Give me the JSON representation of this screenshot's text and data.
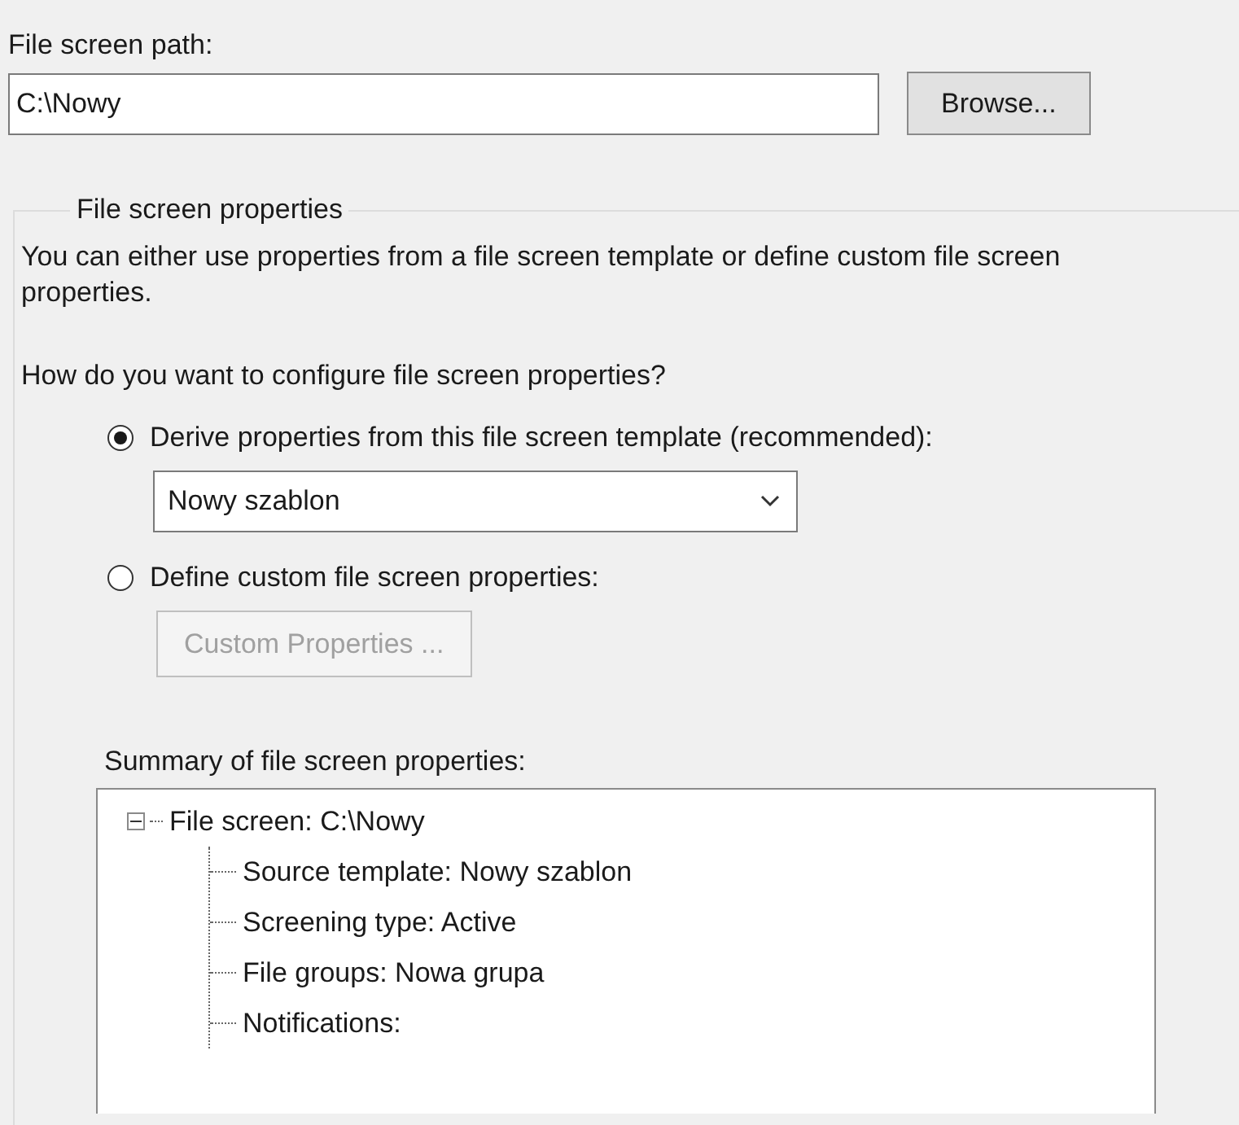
{
  "path_label": "File screen path:",
  "path_value": "C:\\Nowy",
  "browse_button": "Browse...",
  "group": {
    "legend": "File screen properties",
    "description": "You can either use properties from a file screen template or define custom file screen properties.",
    "question": "How do you want to configure file screen properties?",
    "options": [
      {
        "kind": "template",
        "label": "Derive properties from this file screen template (recommended):",
        "selected": true,
        "dropdown_value": "Nowy szablon"
      },
      {
        "kind": "custom",
        "label": "Define custom file screen properties:",
        "selected": false,
        "button": "Custom Properties ...",
        "button_disabled": true
      }
    ],
    "summary_label": "Summary of file screen properties:",
    "summary_tree": [
      {
        "label": "File screen: C:\\Nowy",
        "expanded": true,
        "children": [
          {
            "label": "Source template: Nowy szablon"
          },
          {
            "label": "Screening type: Active"
          },
          {
            "label": "File groups: Nowa grupa"
          },
          {
            "label": "Notifications:"
          }
        ]
      }
    ]
  }
}
